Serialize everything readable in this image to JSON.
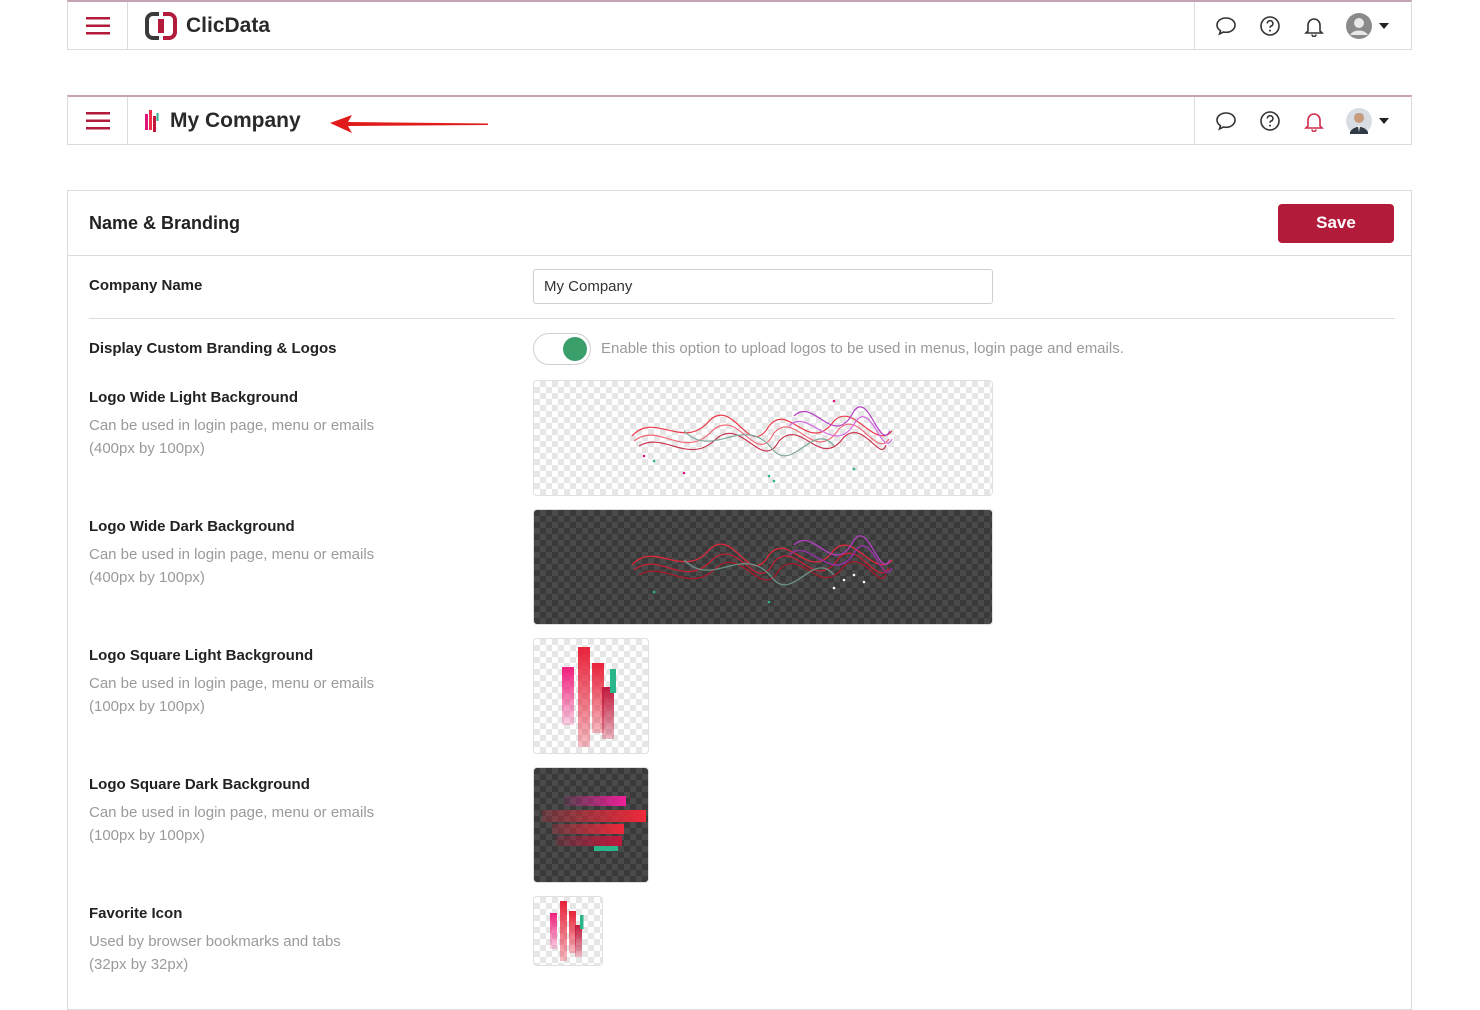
{
  "top_bar": {
    "brand_name": "ClicData",
    "icons": [
      "menu-icon",
      "chat-icon",
      "help-icon",
      "bell-icon",
      "user-avatar-icon",
      "caret-down-icon"
    ]
  },
  "company_bar": {
    "company_name": "My Company",
    "icons": [
      "menu-icon",
      "chat-icon",
      "help-icon",
      "bell-icon",
      "user-photo-avatar",
      "caret-down-icon"
    ]
  },
  "annotation": {
    "arrow_icon": "red-arrow-left-icon"
  },
  "panel": {
    "title": "Name & Branding",
    "save_label": "Save",
    "company_name_label": "Company Name",
    "company_name_value": "My Company",
    "branding_label": "Display Custom Branding & Logos",
    "branding_toggle_on": true,
    "branding_help": "Enable this option to upload logos to be used in menus, login page and emails.",
    "logos": [
      {
        "label": "Logo Wide Light Background",
        "desc1": "Can be used in login page, menu or emails",
        "desc2": "(400px by 100px)"
      },
      {
        "label": "Logo Wide Dark Background",
        "desc1": "Can be used in login page, menu or emails",
        "desc2": "(400px by 100px)"
      },
      {
        "label": "Logo Square Light Background",
        "desc1": "Can be used in login page, menu or emails",
        "desc2": "(100px by 100px)"
      },
      {
        "label": "Logo Square Dark Background",
        "desc1": "Can be used in login page, menu or emails",
        "desc2": "(100px by 100px)"
      },
      {
        "label": "Favorite Icon",
        "desc1": "Used by browser bookmarks and tabs",
        "desc2": "(32px by 32px)"
      }
    ]
  },
  "colors": {
    "accent": "#b31b3a",
    "toggle_on": "#3a9f6b",
    "burger": "#b31b3a"
  }
}
